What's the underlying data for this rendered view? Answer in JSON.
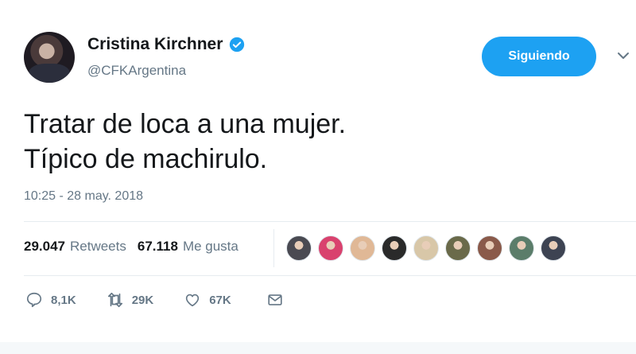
{
  "user": {
    "name": "Cristina Kirchner",
    "handle": "@CFKArgentina",
    "verified": true
  },
  "follow_button": {
    "label": "Siguiendo"
  },
  "tweet": {
    "lines": [
      "Tratar de loca a una mujer.",
      "Típico de machirulo."
    ],
    "timestamp": "10:25 - 28 may. 2018"
  },
  "stats": {
    "retweets_count": "29.047",
    "retweets_label": "Retweets",
    "likes_count": "67.118",
    "likes_label": "Me gusta"
  },
  "likers": [
    {
      "icon": "avatar-liker",
      "color": "#4a4a52"
    },
    {
      "icon": "avatar-liker",
      "color": "#d9426e"
    },
    {
      "icon": "avatar-liker",
      "color": "#e0b896"
    },
    {
      "icon": "avatar-liker",
      "color": "#2a2a2a"
    },
    {
      "icon": "avatar-liker",
      "color": "#d8c7a8"
    },
    {
      "icon": "avatar-liker",
      "color": "#6a6a4a"
    },
    {
      "icon": "avatar-liker",
      "color": "#8a5a4a"
    },
    {
      "icon": "avatar-liker",
      "color": "#5b7d6a"
    },
    {
      "icon": "avatar-liker",
      "color": "#3d4352"
    }
  ],
  "actions": {
    "reply_count": "8,1K",
    "retweet_count": "29K",
    "like_count": "67K"
  },
  "colors": {
    "accent": "#1da1f2",
    "secondary_text": "#657786",
    "primary_text": "#14171a"
  }
}
